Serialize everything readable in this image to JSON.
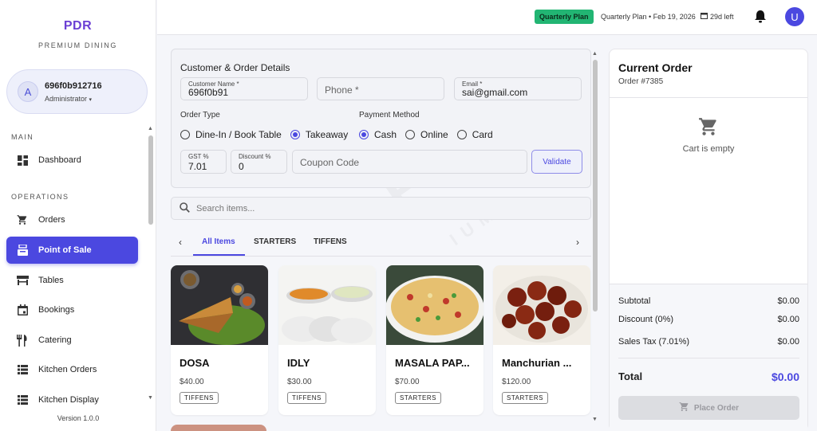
{
  "brand": {
    "name": "PDR",
    "tagline": "PREMIUM DINING",
    "watermark": "PDR",
    "watermark_sub": "IUM"
  },
  "user": {
    "initial": "A",
    "id": "696f0b912716",
    "role": "Administrator",
    "role_caret": "▾"
  },
  "sidebar": {
    "sections": {
      "main": "MAIN",
      "operations": "OPERATIONS"
    },
    "items": [
      {
        "label": "Dashboard",
        "icon": "dashboard-icon"
      },
      {
        "label": "Orders",
        "icon": "cart-icon"
      },
      {
        "label": "Point of Sale",
        "icon": "pos-icon",
        "active": true
      },
      {
        "label": "Tables",
        "icon": "table-icon"
      },
      {
        "label": "Bookings",
        "icon": "calendar-icon"
      },
      {
        "label": "Catering",
        "icon": "utensils-icon"
      },
      {
        "label": "Kitchen Orders",
        "icon": "list-icon"
      },
      {
        "label": "Kitchen Display",
        "icon": "list-icon"
      }
    ],
    "version": "Version 1.0.0"
  },
  "topbar": {
    "plan_badge": "Quarterly Plan",
    "plan_info": "Quarterly Plan • Feb 19, 2026",
    "days_left": "29d left",
    "avatar_initial": "U"
  },
  "details": {
    "title": "Customer & Order Details",
    "customer_name_label": "Customer Name *",
    "customer_name_value": "696f0b91",
    "phone_placeholder": "Phone *",
    "email_label": "Email *",
    "email_value": "sai@gmail.com",
    "order_type_label": "Order Type",
    "order_types": [
      "Dine-In / Book Table",
      "Takeaway"
    ],
    "order_type_selected": "Takeaway",
    "payment_label": "Payment Method",
    "payment_methods": [
      "Cash",
      "Online",
      "Card"
    ],
    "payment_selected": "Cash",
    "gst_label": "GST %",
    "gst_value": "7.01",
    "discount_label": "Discount %",
    "discount_value": "0",
    "coupon_placeholder": "Coupon Code",
    "validate_label": "Validate"
  },
  "search": {
    "placeholder": "Search items..."
  },
  "tabs": [
    "All Items",
    "STARTERS",
    "TIFFENS"
  ],
  "items": [
    {
      "name": "DOSA",
      "price": "$40.00",
      "category": "TIFFENS"
    },
    {
      "name": "IDLY",
      "price": "$30.00",
      "category": "TIFFENS"
    },
    {
      "name": "MASALA PAP...",
      "price": "$70.00",
      "category": "STARTERS"
    },
    {
      "name": "Manchurian ...",
      "price": "$120.00",
      "category": "STARTERS"
    }
  ],
  "order": {
    "title": "Current Order",
    "number": "Order #7385",
    "empty_message": "Cart is empty",
    "subtotal_label": "Subtotal",
    "subtotal_value": "$0.00",
    "discount_label": "Discount (0%)",
    "discount_value": "$0.00",
    "tax_label": "Sales Tax (7.01%)",
    "tax_value": "$0.00",
    "total_label": "Total",
    "total_value": "$0.00",
    "place_label": "Place Order"
  },
  "colors": {
    "accent": "#4b48e0",
    "brand": "#6b3fd4",
    "plan_badge": "#22b573"
  }
}
